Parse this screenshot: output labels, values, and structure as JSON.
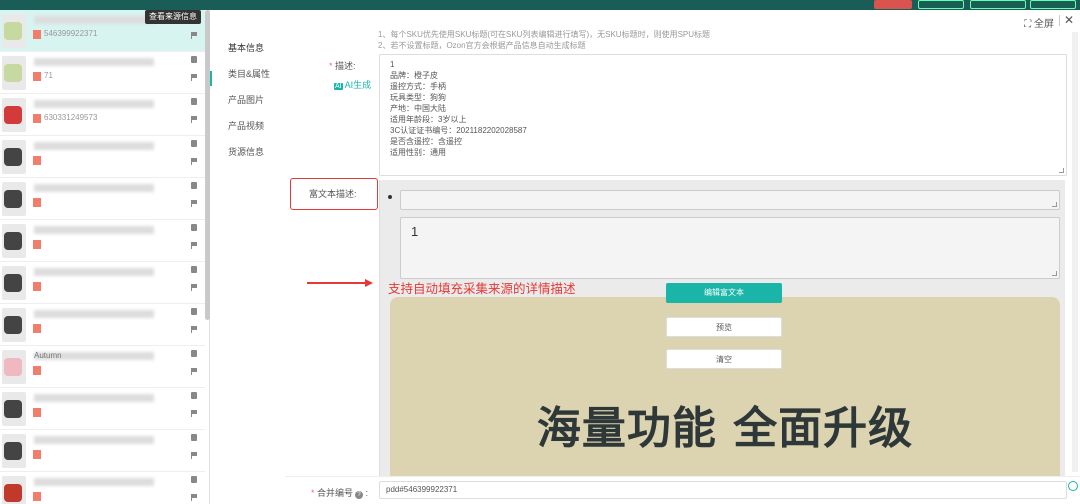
{
  "header": {
    "source_button": "查看来源信息",
    "fullscreen_label": "全屏",
    "close_label": "✕"
  },
  "left_list": {
    "items": [
      {
        "title": "",
        "text": "546399922371",
        "thumb_color": "#c6d9a0",
        "active": true
      },
      {
        "title": "",
        "text": "71",
        "thumb_color": "#c6d9a0",
        "active": false
      },
      {
        "title": "",
        "text": "630331249573",
        "thumb_color": "#d33a3a",
        "active": false
      },
      {
        "title": "",
        "text": "",
        "thumb_color": "#444444",
        "active": false
      },
      {
        "title": "",
        "text": "",
        "thumb_color": "#444444",
        "active": false
      },
      {
        "title": "",
        "text": "",
        "thumb_color": "#444444",
        "active": false
      },
      {
        "title": "",
        "text": "",
        "thumb_color": "#444444",
        "active": false
      },
      {
        "title": "",
        "text": "",
        "thumb_color": "#444444",
        "active": false
      },
      {
        "title": "Autumn",
        "text": "",
        "thumb_color": "#f0b8c0",
        "active": false
      },
      {
        "title": "",
        "text": "",
        "thumb_color": "#444444",
        "active": false
      },
      {
        "title": "",
        "text": "",
        "thumb_color": "#444444",
        "active": false
      },
      {
        "title": "",
        "text": "",
        "thumb_color": "#c0392b",
        "active": false
      }
    ]
  },
  "nav": {
    "items": [
      "基本信息",
      "类目&属性",
      "产品图片",
      "产品视频",
      "货源信息"
    ]
  },
  "form": {
    "hints": [
      "1、每个SKU优先使用SKU标题(可在SKU列表编辑进行填写)，无SKU标题时，则使用SPU标题",
      "2、若不设置标题，Ozon官方会根据产品信息自动生成标题"
    ],
    "description_label": "描述:",
    "ai_label": "AI生成",
    "ai_badge": "AI",
    "description_lines": [
      "1",
      "品牌：橙子皮",
      "遥控方式：手柄",
      "玩具类型：狗狗",
      "产地：中国大陆",
      "适用年龄段：3岁以上",
      "3C认证证书编号：2021182202028587",
      "是否含遥控：含遥控",
      "适用性别：通用"
    ],
    "rich_label": "富文本描述:",
    "rich_value": "1",
    "annotation": "支持自动填充采集来源的详情描述",
    "edit_button": "编辑富文本",
    "preview_button": "预览",
    "clear_button": "清空",
    "banner_text": "海量功能 全面升级",
    "merge_label": "合并编号",
    "merge_value": "pdd#546399922371"
  },
  "colors": {
    "accent": "#1ab5a8",
    "annotation": "#e53935",
    "banner_bg": "#dcd3b0"
  }
}
